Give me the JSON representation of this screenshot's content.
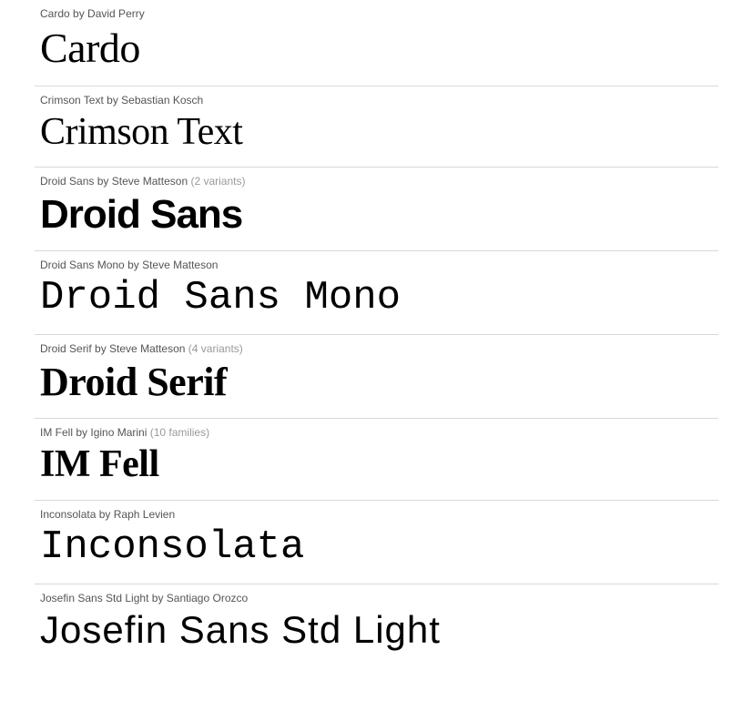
{
  "fonts": [
    {
      "name": "Cardo",
      "author": "David Perry",
      "extra": "",
      "preview": "Cardo",
      "previewClass": "preview-cardo"
    },
    {
      "name": "Crimson Text",
      "author": "Sebastian Kosch",
      "extra": "",
      "preview": "Crimson Text",
      "previewClass": "preview-crimson"
    },
    {
      "name": "Droid Sans",
      "author": "Steve Matteson",
      "extra": "(2 variants)",
      "preview": "Droid Sans",
      "previewClass": "preview-droidsans"
    },
    {
      "name": "Droid Sans Mono",
      "author": "Steve Matteson",
      "extra": "",
      "preview": "Droid Sans Mono",
      "previewClass": "preview-droidsansmono"
    },
    {
      "name": "Droid Serif",
      "author": "Steve Matteson",
      "extra": "(4 variants)",
      "preview": "Droid Serif",
      "previewClass": "preview-droidserif"
    },
    {
      "name": "IM Fell",
      "author": "Igino Marini",
      "extra": "(10 families)",
      "preview": "IM Fell",
      "previewClass": "preview-imfell"
    },
    {
      "name": "Inconsolata",
      "author": "Raph Levien",
      "extra": "",
      "preview": "Inconsolata",
      "previewClass": "preview-inconsolata"
    },
    {
      "name": "Josefin Sans Std Light",
      "author": "Santiago Orozco",
      "extra": "",
      "preview": "Josefin Sans Std Light",
      "previewClass": "preview-josefin"
    }
  ]
}
